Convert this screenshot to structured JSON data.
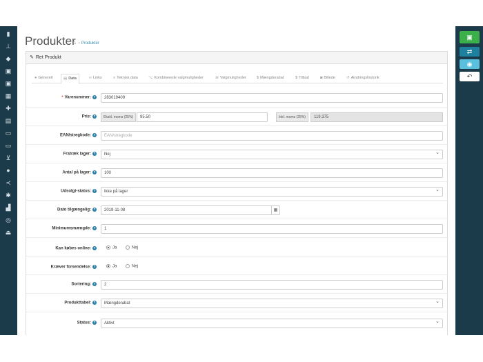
{
  "header": {
    "title": "Produkter",
    "breadcrumb": "Produkter"
  },
  "panel": {
    "title": "Ret Produkt"
  },
  "tabs": [
    {
      "label": "Generelt",
      "icon": "info-icon"
    },
    {
      "label": "Data",
      "icon": "clipboard-icon"
    },
    {
      "label": "Links",
      "icon": "link-icon"
    },
    {
      "label": "Teknisk data",
      "icon": "list-icon"
    },
    {
      "label": "Kombinerede valgmuligheder",
      "icon": "code-icon"
    },
    {
      "label": "Valgmuligheder",
      "icon": "list-icon"
    },
    {
      "label": "Mængderabat",
      "icon": "dollar-icon"
    },
    {
      "label": "Tilbud",
      "icon": "dollar-icon"
    },
    {
      "label": "Billede",
      "icon": "camera-icon"
    },
    {
      "label": "Ændringshistorik",
      "icon": "history-icon"
    }
  ],
  "form": {
    "varenummer": {
      "label": "Varenummer:",
      "value": "283019409"
    },
    "pris": {
      "label": "Pris:",
      "excl_addon": "Ekskl. moms (25%)",
      "excl_value": "95.50",
      "incl_addon": "Inkl. moms (25%)",
      "incl_value": "119.375"
    },
    "ean": {
      "label": "EAN/stregkode:",
      "placeholder": "EAN/stregkode"
    },
    "fratraek": {
      "label": "Fratræk lager:",
      "value": "Nej"
    },
    "antal": {
      "label": "Antal på lager:",
      "value": "100"
    },
    "udsolgt": {
      "label": "Udsolgt-status:",
      "value": "Ikke på lager"
    },
    "dato": {
      "label": "Dato tilgængelig:",
      "value": "2019-11-08"
    },
    "minimum": {
      "label": "Minimumsmængde:",
      "value": "1"
    },
    "kan_koebes": {
      "label": "Kan købes online:",
      "yes": "Ja",
      "no": "Nej"
    },
    "kraever": {
      "label": "Kræver forsendelse:",
      "yes": "Ja",
      "no": "Nej"
    },
    "sortering": {
      "label": "Sortering:",
      "value": "2"
    },
    "produkttabel": {
      "label": "Produkttabel:",
      "value": "Mængderabat"
    },
    "status": {
      "label": "Status:",
      "value": "Aktivt"
    }
  },
  "colors": {
    "sidebar": "#1b3a4a",
    "save": "#3bb04a",
    "accent": "#2a7ea8"
  }
}
